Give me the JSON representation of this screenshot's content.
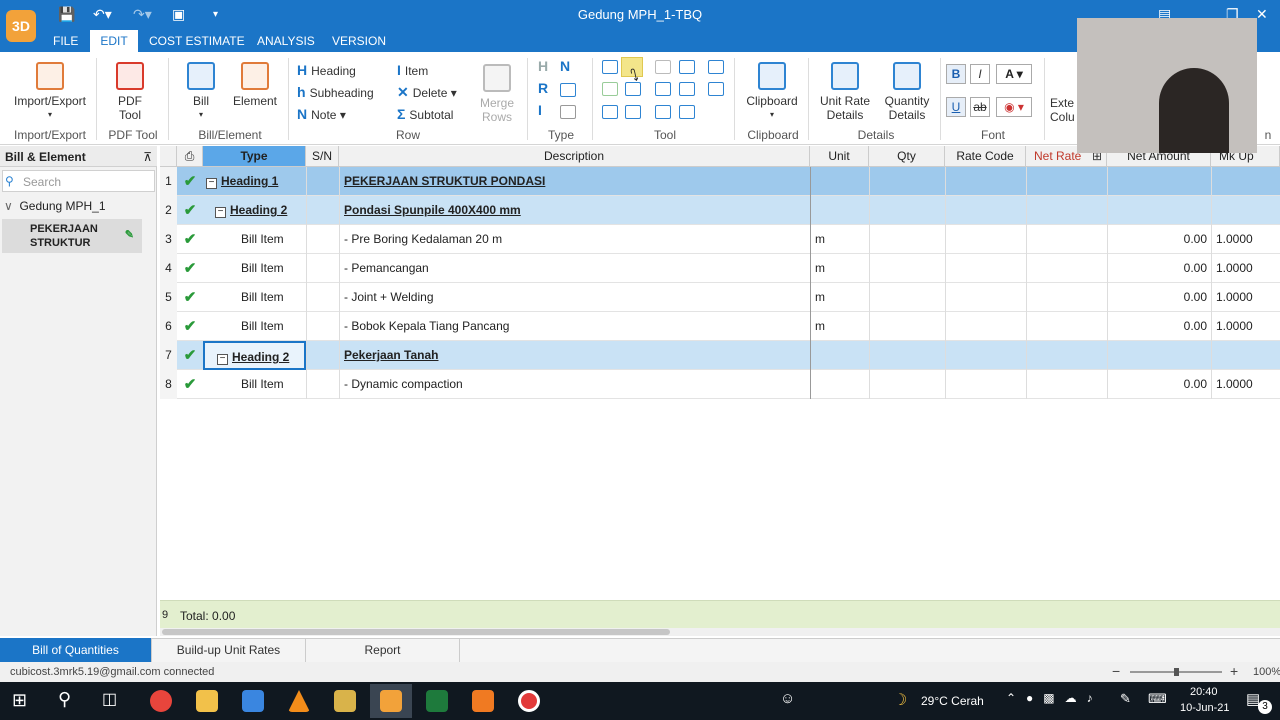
{
  "window": {
    "title": "Gedung MPH_1-TBQ"
  },
  "menu": [
    "FILE",
    "EDIT",
    "COST ESTIMATE",
    "ANALYSIS",
    "VERSION"
  ],
  "ribbon": {
    "import_export": "Import/Export",
    "pdf_tool_1": "PDF",
    "pdf_tool_2": "Tool",
    "bill": "Bill",
    "element": "Element",
    "heading": "Heading",
    "subheading": "Subheading",
    "note": "Note",
    "item": "Item",
    "delete": "Delete",
    "subtotal": "Subtotal",
    "merge_1": "Merge",
    "merge_2": "Rows",
    "clipboard": "Clipboard",
    "unit_rate_1": "Unit Rate",
    "unit_rate_2": "Details",
    "qty_1": "Quantity",
    "qty_2": "Details",
    "ext_1": "Exte",
    "ext_2": "Colu",
    "groups": {
      "import_export": "Import/Export",
      "pdf_tool": "PDF Tool",
      "bill_element": "Bill/Element",
      "row": "Row",
      "type": "Type",
      "tool": "Tool",
      "clipboard": "Clipboard",
      "details": "Details",
      "font": "Font",
      "last": "n"
    }
  },
  "left_panel": {
    "title": "Bill & Element",
    "search_placeholder": "Search",
    "node": "Gedung MPH_1",
    "child_1": "PEKERJAAN",
    "child_2": "STRUKTUR"
  },
  "grid": {
    "columns": [
      "Type",
      "S/N",
      "Description",
      "Unit",
      "Qty",
      "Rate Code",
      "Net Rate",
      "Net Amount",
      "Mk Up Ratio"
    ],
    "rows": [
      {
        "n": "1",
        "type": "Heading 1",
        "desc": "PEKERJAAN STRUKTUR PONDASI",
        "unit": "",
        "amount": "",
        "ratio": ""
      },
      {
        "n": "2",
        "type": "Heading 2",
        "desc": "Pondasi Spunpile 400X400 mm",
        "unit": "",
        "amount": "",
        "ratio": ""
      },
      {
        "n": "3",
        "type": "Bill Item",
        "desc": "- Pre Boring Kedalaman 20 m",
        "unit": "m",
        "amount": "0.00",
        "ratio": "1.0000"
      },
      {
        "n": "4",
        "type": "Bill Item",
        "desc": "- Pemancangan",
        "unit": "m",
        "amount": "0.00",
        "ratio": "1.0000"
      },
      {
        "n": "5",
        "type": "Bill Item",
        "desc": "- Joint + Welding",
        "unit": "m",
        "amount": "0.00",
        "ratio": "1.0000"
      },
      {
        "n": "6",
        "type": "Bill Item",
        "desc": "- Bobok Kepala Tiang Pancang",
        "unit": "m",
        "amount": "0.00",
        "ratio": "1.0000"
      },
      {
        "n": "7",
        "type": "Heading 2",
        "desc": "Pekerjaan Tanah",
        "unit": "",
        "amount": "",
        "ratio": ""
      },
      {
        "n": "8",
        "type": "Bill Item",
        "desc": "- Dynamic compaction",
        "unit": "",
        "amount": "0.00",
        "ratio": "1.0000"
      }
    ],
    "total_row_no": "9",
    "total": "Total: 0.00"
  },
  "tabs": [
    "Bill of Quantities",
    "Build-up Unit Rates",
    "Report"
  ],
  "status": {
    "text": "cubicost.3mrk5.19@gmail.com connected",
    "zoom": "100%"
  },
  "taskbar": {
    "weather": "29°C  Cerah",
    "time": "20:40",
    "date": "10-Jun-21",
    "notif": "3"
  }
}
